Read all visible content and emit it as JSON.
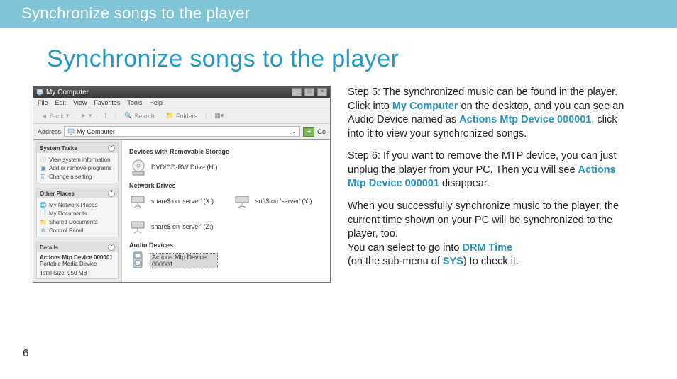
{
  "topbar": {
    "text": "Synchronize songs to the player"
  },
  "title": "Synchronize songs to the player",
  "window": {
    "title": "My Computer",
    "menus": [
      "File",
      "Edit",
      "View",
      "Favorites",
      "Tools",
      "Help"
    ],
    "toolbar": {
      "back": "Back",
      "search": "Search",
      "folders": "Folders"
    },
    "address_label": "Address",
    "address_value": "My Computer",
    "go_label": "Go"
  },
  "left_pane": {
    "system_tasks": {
      "title": "System Tasks",
      "items": [
        "View system information",
        "Add or remove programs",
        "Change a setting"
      ]
    },
    "other_places": {
      "title": "Other Places",
      "items": [
        "My Network Places",
        "My Documents",
        "Shared Documents",
        "Control Panel"
      ]
    },
    "details": {
      "title": "Details",
      "device_name": "Actions Mtp Device 000001",
      "device_type": "Portable Media Device",
      "total_size": "Total Size: 950 MB"
    }
  },
  "groups": {
    "removable": {
      "title": "Devices with Removable Storage",
      "items": [
        {
          "label": "DVD/CD-RW Drive (H:)"
        }
      ]
    },
    "network": {
      "title": "Network Drives",
      "items": [
        {
          "label": "share$ on 'server' (X:)"
        },
        {
          "label": "soft$ on 'server' (Y:)"
        },
        {
          "label": "share$ on 'server' (Z:)"
        }
      ]
    },
    "audio": {
      "title": "Audio Devices",
      "items": [
        {
          "label": "Actions Mtp Device 000001"
        }
      ]
    }
  },
  "instructions": {
    "step5_pre": "Step 5: The synchronized music can be found in the player. Click into ",
    "kw_mycomputer": "My Computer",
    "step5_mid": " on the desktop, and you can see an Audio Device named as ",
    "kw_device1": "Actions Mtp Device 000001",
    "step5_post": ", click into it to view your synchronized songs.",
    "step6_pre": "Step 6: If you want to remove the MTP device, you can just unplug the player from your PC. Then you will see ",
    "kw_device2": "Actions Mtp Device 000001",
    "step6_post": " disappear.",
    "sync_time": "When you successfully synchronize music to the player, the current time shown on your PC will be synchronized to the player, too.",
    "drm_pre": "You can select to go into ",
    "kw_drm": "DRM Time",
    "drm_mid": "(on the sub-menu of ",
    "kw_sys": "SYS",
    "drm_post": ") to check it."
  },
  "page_number": "6"
}
